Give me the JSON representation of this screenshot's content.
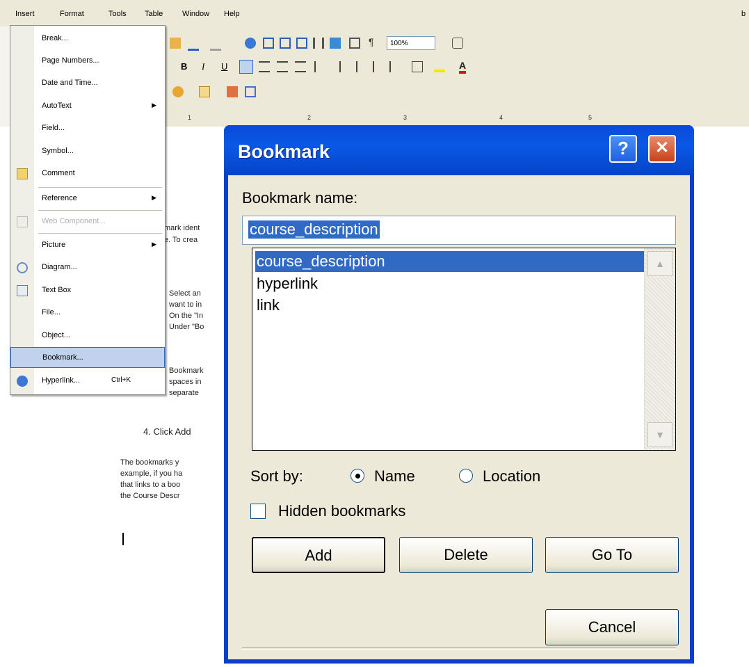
{
  "menubar": {
    "items": [
      "Insert",
      "Format",
      "Tools",
      "Table",
      "Window",
      "Help"
    ],
    "right_fragment": "b"
  },
  "toolbar": {
    "zoom": "100%"
  },
  "ruler": {
    "numbers": [
      "1",
      "2",
      "3",
      "4",
      "5"
    ]
  },
  "document": {
    "lines": [
      "mark ident",
      "e. To crea",
      "Select an",
      "want to in",
      "On the \"In",
      "Under \"Bo",
      "Bookmark",
      "spaces in",
      "separate",
      "4.   Click Add",
      "The bookmarks y",
      "example, if you ha",
      "that links to a boo",
      "the Course Descr"
    ]
  },
  "insert_menu": {
    "items": [
      {
        "label": "Break...",
        "icon": "",
        "arrow": false,
        "shortcut": ""
      },
      {
        "label": "Page Numbers...",
        "icon": "",
        "arrow": false,
        "shortcut": ""
      },
      {
        "label": "Date and Time...",
        "icon": "",
        "arrow": false,
        "shortcut": ""
      },
      {
        "label": "AutoText",
        "icon": "",
        "arrow": true,
        "shortcut": ""
      },
      {
        "label": "Field...",
        "icon": "",
        "arrow": false,
        "shortcut": ""
      },
      {
        "label": "Symbol...",
        "icon": "",
        "arrow": false,
        "shortcut": ""
      },
      {
        "label": "Comment",
        "icon": "comment-icon",
        "arrow": false,
        "shortcut": ""
      },
      {
        "label": "Reference",
        "icon": "",
        "arrow": true,
        "shortcut": ""
      },
      {
        "label": "Web Component...",
        "icon": "web-component-icon",
        "arrow": false,
        "shortcut": "",
        "disabled": true
      },
      {
        "label": "Picture",
        "icon": "",
        "arrow": true,
        "shortcut": ""
      },
      {
        "label": "Diagram...",
        "icon": "diagram-icon",
        "arrow": false,
        "shortcut": ""
      },
      {
        "label": "Text Box",
        "icon": "text-box-icon",
        "arrow": false,
        "shortcut": ""
      },
      {
        "label": "File...",
        "icon": "",
        "arrow": false,
        "shortcut": ""
      },
      {
        "label": "Object...",
        "icon": "",
        "arrow": false,
        "shortcut": ""
      },
      {
        "label": "Bookmark...",
        "icon": "",
        "arrow": false,
        "shortcut": "",
        "highlighted": true
      },
      {
        "label": "Hyperlink...",
        "icon": "hyperlink-icon",
        "arrow": false,
        "shortcut": "Ctrl+K"
      }
    ]
  },
  "dialog": {
    "title": "Bookmark",
    "help_glyph": "?",
    "close_glyph": "✕",
    "name_label": "Bookmark name:",
    "name_value": "course_description",
    "bookmarks": [
      "course_description",
      "hyperlink",
      "link"
    ],
    "selected_index": 0,
    "sort_label": "Sort by:",
    "sort_options": [
      "Name",
      "Location"
    ],
    "sort_selected": "Name",
    "hidden_label": "Hidden bookmarks",
    "hidden_checked": false,
    "buttons": {
      "add": "Add",
      "delete": "Delete",
      "goto": "Go To",
      "cancel": "Cancel"
    },
    "scroll_up": "▲",
    "scroll_down": "▼"
  }
}
